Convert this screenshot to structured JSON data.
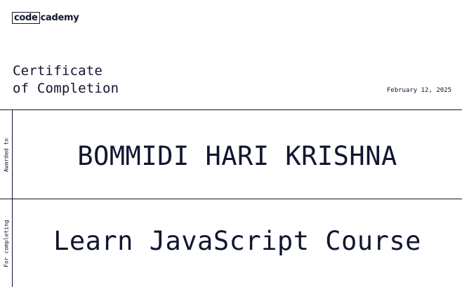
{
  "logo": {
    "boxed": "code",
    "rest": "cademy"
  },
  "certificate": {
    "title_line1": "Certificate",
    "title_line2": "of Completion",
    "date": "February 12, 2025"
  },
  "awarded": {
    "label": "Awarded to",
    "recipient": "BOMMIDI HARI KRISHNA"
  },
  "completed": {
    "label": "For completing",
    "course": "Learn JavaScript Course"
  },
  "colors": {
    "ink": "#10162f",
    "background": "#ffffff"
  }
}
